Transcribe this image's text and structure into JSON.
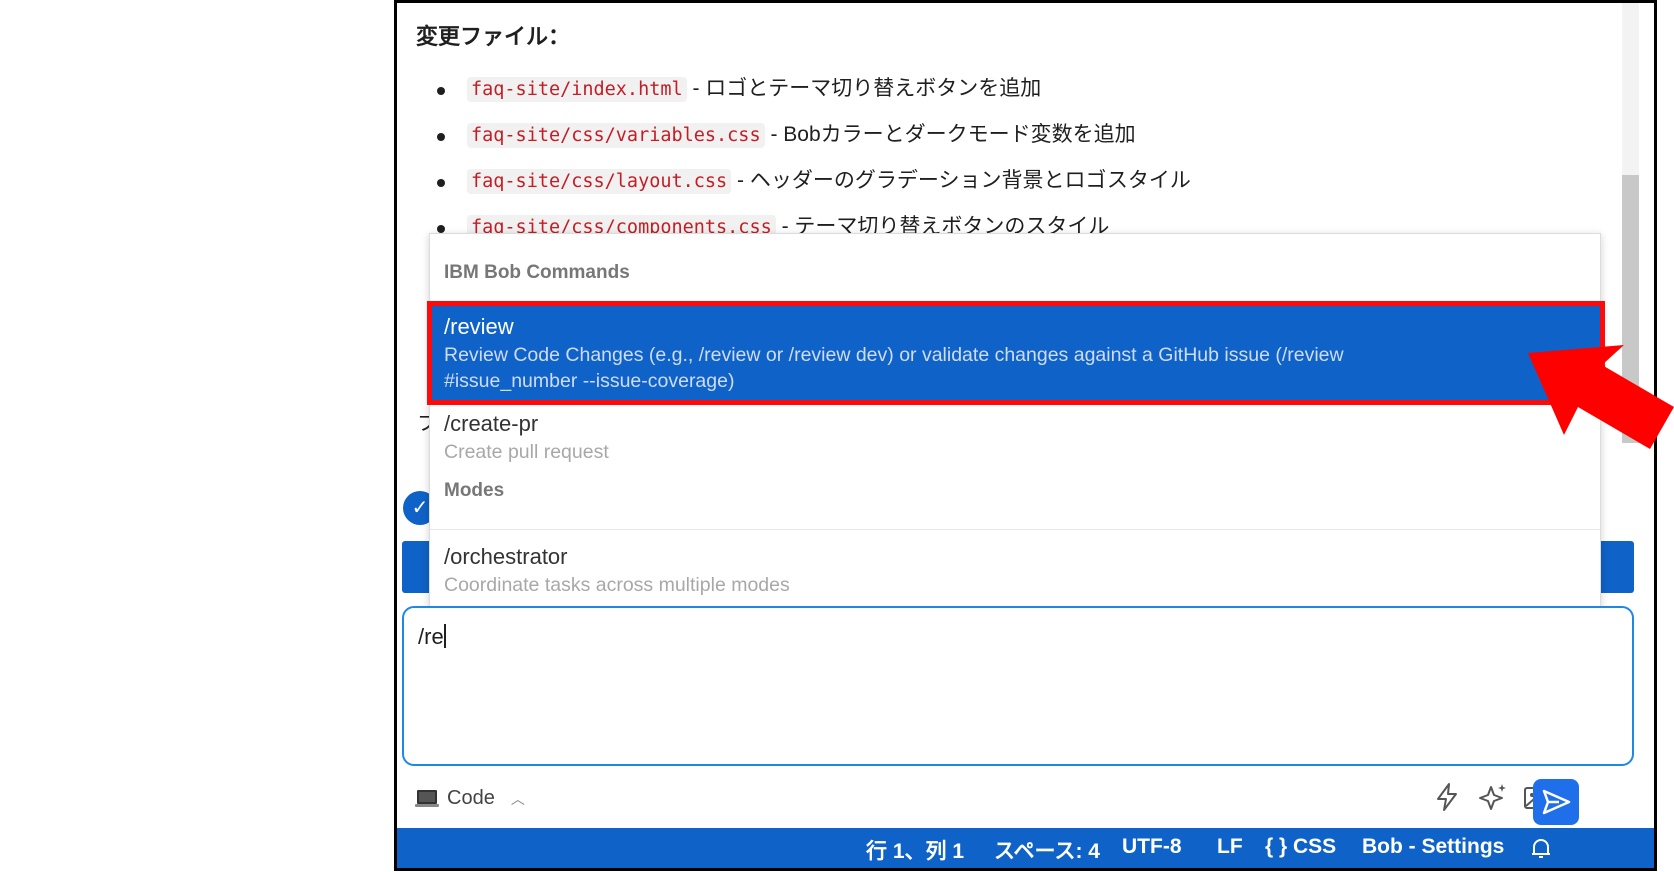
{
  "message": {
    "title": "変更ファイル：",
    "files": [
      {
        "path": "faq-site/index.html",
        "desc": "- ロゴとテーマ切り替えボタンを追加"
      },
      {
        "path": "faq-site/css/variables.css",
        "desc": "- Bobカラーとダークモード変数を追加"
      },
      {
        "path": "faq-site/css/layout.css",
        "desc": "- ヘッダーのグラデーション背景とロゴスタイル"
      },
      {
        "path": "faq-site/css/components.css",
        "desc": "- テーマ切り替えボタンのスタイル"
      }
    ],
    "partial_char": "フ"
  },
  "dropdown": {
    "section1": "IBM Bob Commands",
    "review": {
      "name": "/review",
      "desc1": "Review Code Changes (e.g., /review or /review dev) or validate changes against a GitHub issue (/review",
      "desc2": "#issue_number --issue-coverage)"
    },
    "createpr": {
      "name": "/create-pr",
      "desc": "Create pull request"
    },
    "section2": "Modes",
    "orchestrator": {
      "name": "/orchestrator",
      "desc": "Coordinate tasks across multiple modes"
    }
  },
  "input": {
    "value": "/re"
  },
  "toolbar": {
    "mode_label": "Code"
  },
  "status": {
    "position": "行 1、列 1",
    "spaces": "スペース: 4",
    "encoding": "UTF-8",
    "eol": "LF",
    "language": "{ } CSS",
    "bob_settings": "Bob - Settings"
  },
  "colors": {
    "accent": "#0f62c7",
    "highlight_border": "#ff0a0a",
    "code_text": "#c41d24"
  }
}
